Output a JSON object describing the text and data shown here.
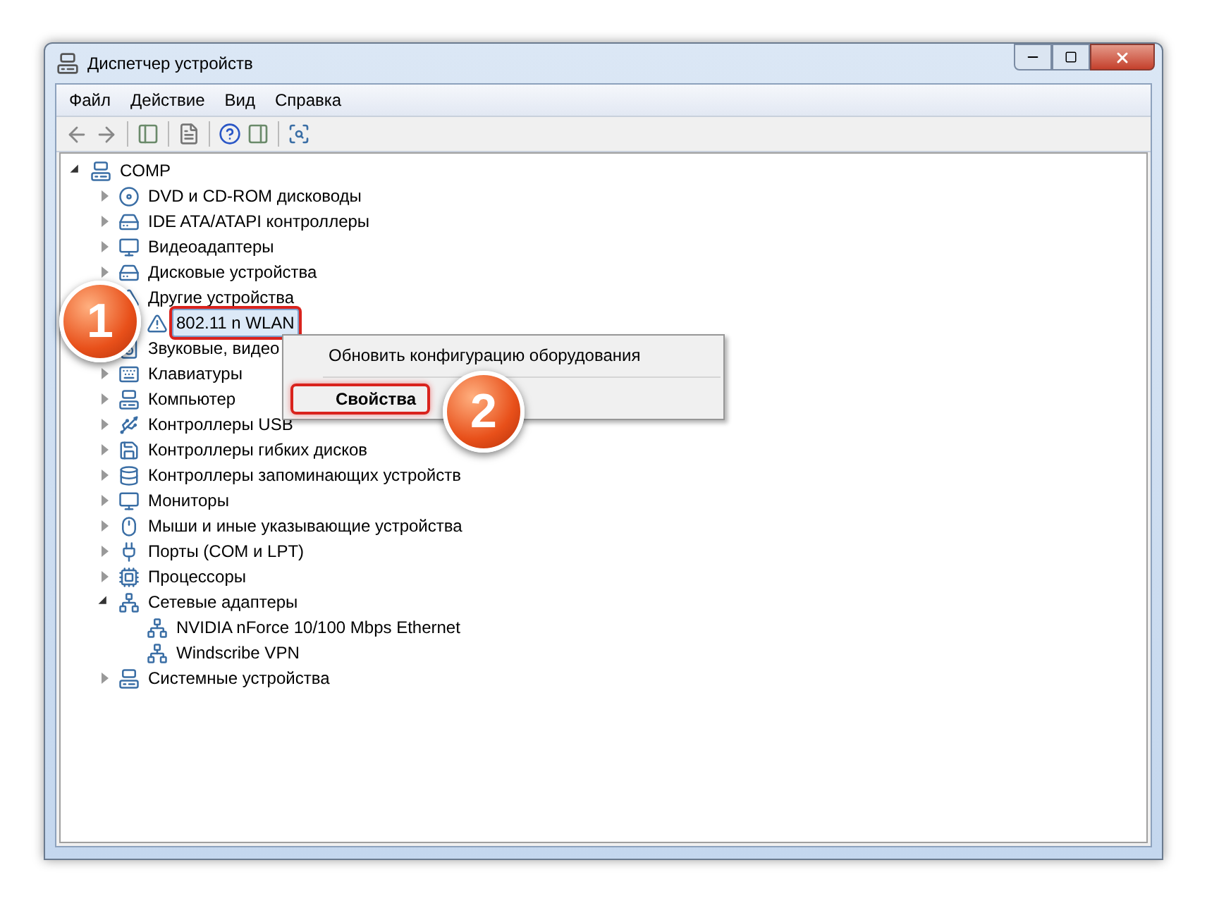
{
  "window": {
    "title": "Диспетчер устройств"
  },
  "menu": [
    "Файл",
    "Действие",
    "Вид",
    "Справка"
  ],
  "tree": [
    {
      "label": "COMP",
      "expanded": true,
      "selected": false,
      "children": [
        {
          "label": "DVD и CD-ROM дисководы",
          "expanded": false,
          "selected": false
        },
        {
          "label": "IDE ATA/ATAPI контроллеры",
          "expanded": false,
          "selected": false
        },
        {
          "label": "Видеоадаптеры",
          "expanded": false,
          "selected": false
        },
        {
          "label": "Дисковые устройства",
          "expanded": false,
          "selected": false
        },
        {
          "label": "Другие устройства",
          "selected": false,
          "children": [
            {
              "label": "802.11 n WLAN",
              "selected": true
            }
          ]
        },
        {
          "label": "Звуковые, видео",
          "selected": false
        },
        {
          "label": "Клавиатуры",
          "expanded": false,
          "selected": false
        },
        {
          "label": "Компьютер",
          "expanded": false,
          "selected": false
        },
        {
          "label": "Контроллеры USB",
          "expanded": false,
          "selected": false
        },
        {
          "label": "Контроллеры гибких дисков",
          "expanded": false,
          "selected": false
        },
        {
          "label": "Контроллеры запоминающих устройств",
          "expanded": false,
          "selected": false
        },
        {
          "label": "Мониторы",
          "expanded": false,
          "selected": false
        },
        {
          "label": "Мыши и иные указывающие устройства",
          "expanded": false,
          "selected": false
        },
        {
          "label": "Порты (COM и LPT)",
          "expanded": false,
          "selected": false
        },
        {
          "label": "Процессоры",
          "expanded": false,
          "selected": false
        },
        {
          "label": "Сетевые адаптеры",
          "expanded": true,
          "selected": false,
          "children": [
            {
              "label": "NVIDIA nForce 10/100 Mbps Ethernet",
              "selected": false
            },
            {
              "label": "Windscribe VPN",
              "selected": false
            }
          ]
        },
        {
          "label": "Системные устройства",
          "expanded": false,
          "selected": false
        }
      ]
    }
  ],
  "context_menu": [
    {
      "label": "Обновить конфигурацию оборудования",
      "selected": false
    },
    {
      "label": "Свойства",
      "selected": true
    }
  ],
  "step_badges": [
    "1",
    "2"
  ]
}
